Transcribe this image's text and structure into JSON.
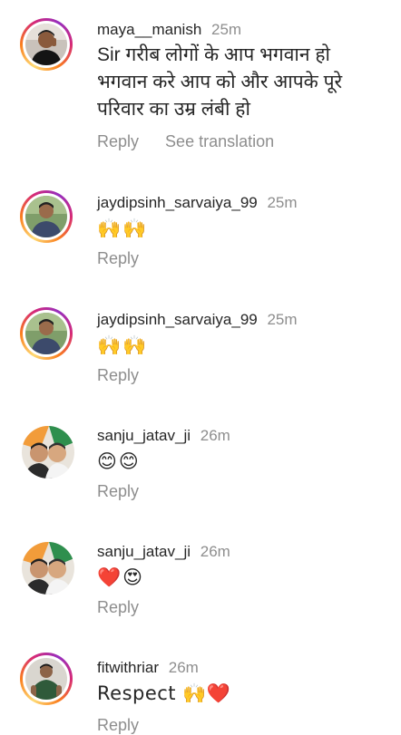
{
  "comments": [
    {
      "username": "maya__manish",
      "time": "25m",
      "text_lines": [
        "Sir गरीब लोगों के आप भगवान हो",
        "भगवान करे आप को और आपके पूरे",
        "परिवार का उम्र लंबी हो"
      ],
      "reply_label": "Reply",
      "translate_label": "See translation"
    },
    {
      "username": "jaydipsinh_sarvaiya_99",
      "time": "25m",
      "text": "🙌🙌",
      "reply_label": "Reply"
    },
    {
      "username": "jaydipsinh_sarvaiya_99",
      "time": "25m",
      "text": "🙌🙌",
      "reply_label": "Reply"
    },
    {
      "username": "sanju_jatav_ji",
      "time": "26m",
      "text": "😊😊",
      "reply_label": "Reply"
    },
    {
      "username": "sanju_jatav_ji",
      "time": "26m",
      "text": "❤️😍",
      "reply_label": "Reply"
    },
    {
      "username": "fitwithriar",
      "time": "26m",
      "text": "Respect 🙌❤️",
      "reply_label": "Reply"
    }
  ],
  "icons": {
    "avatar_ring_colors": [
      "#feda75",
      "#fa7e1e",
      "#d62976",
      "#962fbf"
    ]
  }
}
